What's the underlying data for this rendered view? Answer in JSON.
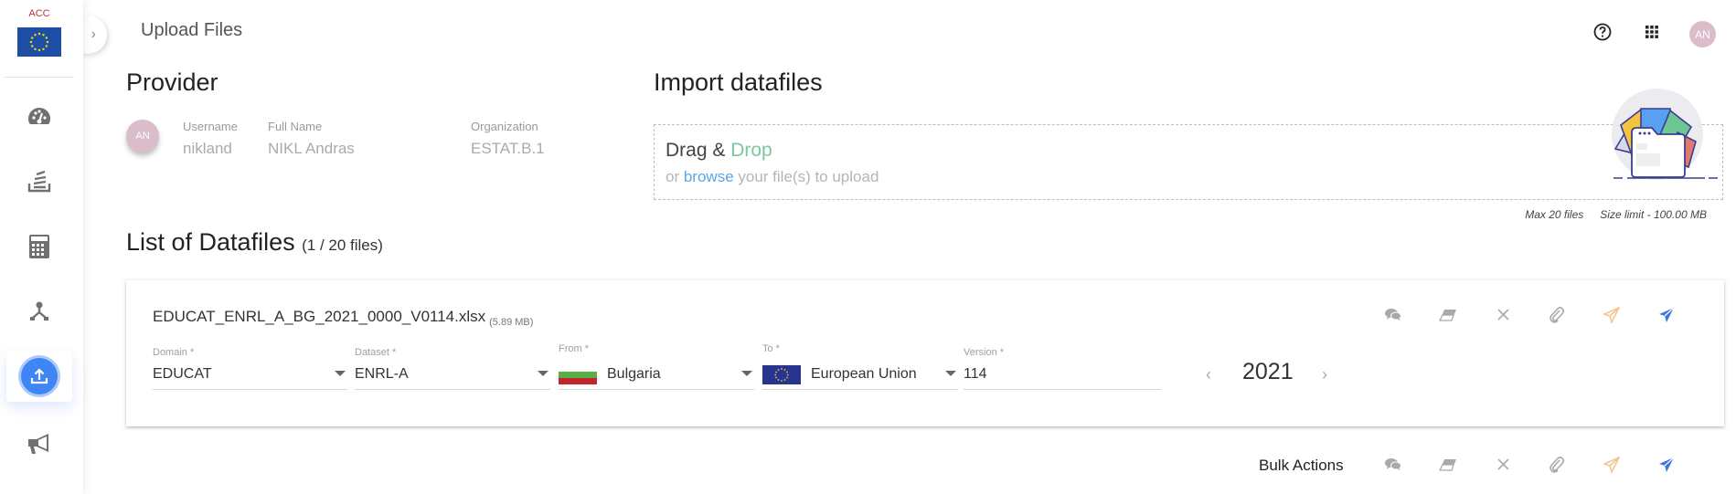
{
  "sidebar": {
    "env_label": "ACC",
    "items": [
      {
        "name": "dashboard",
        "icon": "dashboard-gauge-icon",
        "active": false
      },
      {
        "name": "datasets",
        "icon": "stack-icon",
        "active": false
      },
      {
        "name": "calculator",
        "icon": "calculator-icon",
        "active": false
      },
      {
        "name": "workflow",
        "icon": "hierarchy-icon",
        "active": false
      },
      {
        "name": "upload",
        "icon": "upload-icon",
        "active": true
      },
      {
        "name": "announcements",
        "icon": "megaphone-icon",
        "active": false
      }
    ],
    "collapse_glyph": "›"
  },
  "header": {
    "title": "Upload Files",
    "help_icon": "help-circle-icon",
    "apps_icon": "apps-grid-icon",
    "avatar_initials": "AN"
  },
  "provider": {
    "title": "Provider",
    "avatar_initials": "AN",
    "fields": [
      {
        "label": "Username",
        "value": "nikland"
      },
      {
        "label": "Full Name",
        "value": "NIKL Andras"
      },
      {
        "label": "Organization",
        "value": "ESTAT.B.1"
      }
    ]
  },
  "import": {
    "title": "Import datafiles",
    "drag_text": "Drag & ",
    "drop_text": "Drop",
    "or_text": "or ",
    "browse_text": "browse",
    "rest_text": " your file(s) to upload",
    "max_files": "Max 20 files",
    "size_limit": "Size limit - 100.00 MB"
  },
  "list": {
    "title": "List of Datafiles",
    "count": "(1 / 20 files)",
    "files": [
      {
        "filename": "EDUCAT_ENRL_A_BG_2021_0000_V0114.xlsx",
        "size": "(5.89 MB)",
        "domain": {
          "label": "Domain *",
          "value": "EDUCAT"
        },
        "dataset": {
          "label": "Dataset *",
          "value": "ENRL-A"
        },
        "from": {
          "label": "From *",
          "value": "Bulgaria"
        },
        "to": {
          "label": "To *",
          "value": "European Union"
        },
        "version": {
          "label": "Version *",
          "value": "114"
        },
        "year": "2021",
        "prev_glyph": "‹",
        "next_glyph": "›"
      }
    ]
  },
  "actions": {
    "icons": [
      "comments-icon",
      "eraser-icon",
      "close-icon",
      "paperclip-icon",
      "send-outline-icon",
      "send-icon"
    ],
    "colors": {
      "muted": "#a9a9a9",
      "send_outline": "#f5c58f",
      "send": "#3a78de"
    }
  },
  "bulk": {
    "label": "Bulk Actions"
  }
}
